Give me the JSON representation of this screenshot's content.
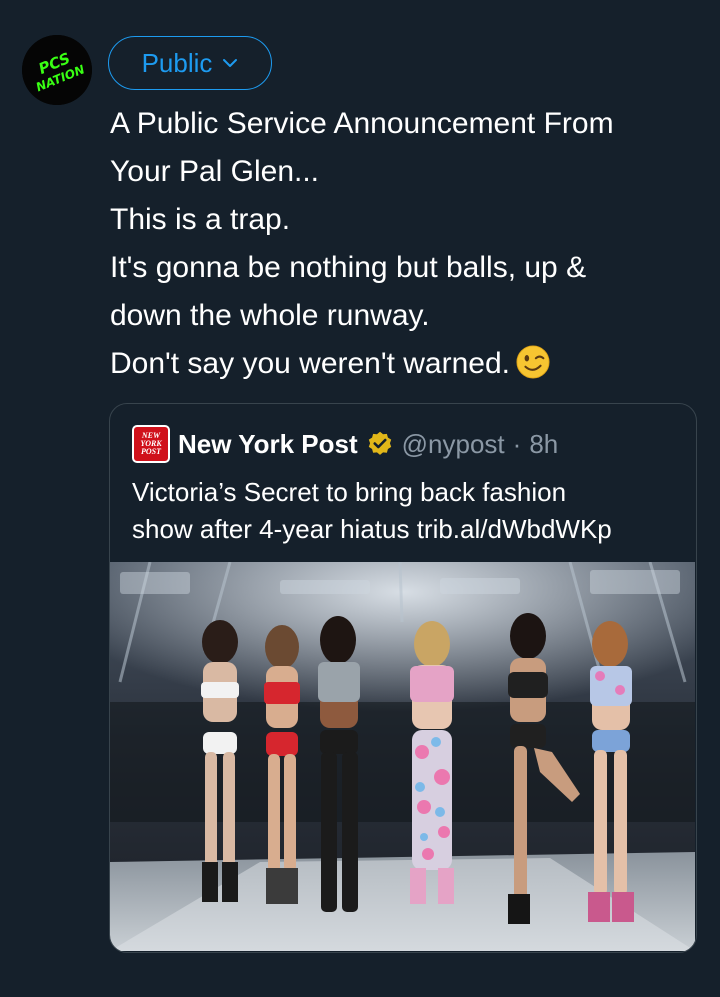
{
  "avatar": {
    "text_line1": "PCS",
    "text_line2": "NATION",
    "accent": "#39ff14"
  },
  "audience": {
    "label": "Public",
    "icon": "chevron-down-icon"
  },
  "tweet": {
    "lines": [
      "A Public Service Announcement From",
      "Your Pal Glen...",
      "This is a trap.",
      "It's gonna be nothing but balls, up &",
      "down the whole runway.",
      "Don't say you weren't warned."
    ],
    "emoji": "winking-face-icon"
  },
  "quote": {
    "logo_lines": [
      "NEW",
      "YORK",
      "POST"
    ],
    "name": "New York Post",
    "verified_icon": "verified-badge-icon",
    "handle": "@nypost",
    "separator": "·",
    "time": "8h",
    "text_lines": [
      "Victoria’s Secret to bring back fashion",
      "show after 4-year hiatus trib.al/dWbdWKp"
    ]
  },
  "colors": {
    "background": "#15202b",
    "accent": "#1d9bf0",
    "secondary_text": "#8b98a5",
    "border": "#38444d",
    "nypost_red": "#d0111b",
    "verified_gold": "#e2b719"
  }
}
